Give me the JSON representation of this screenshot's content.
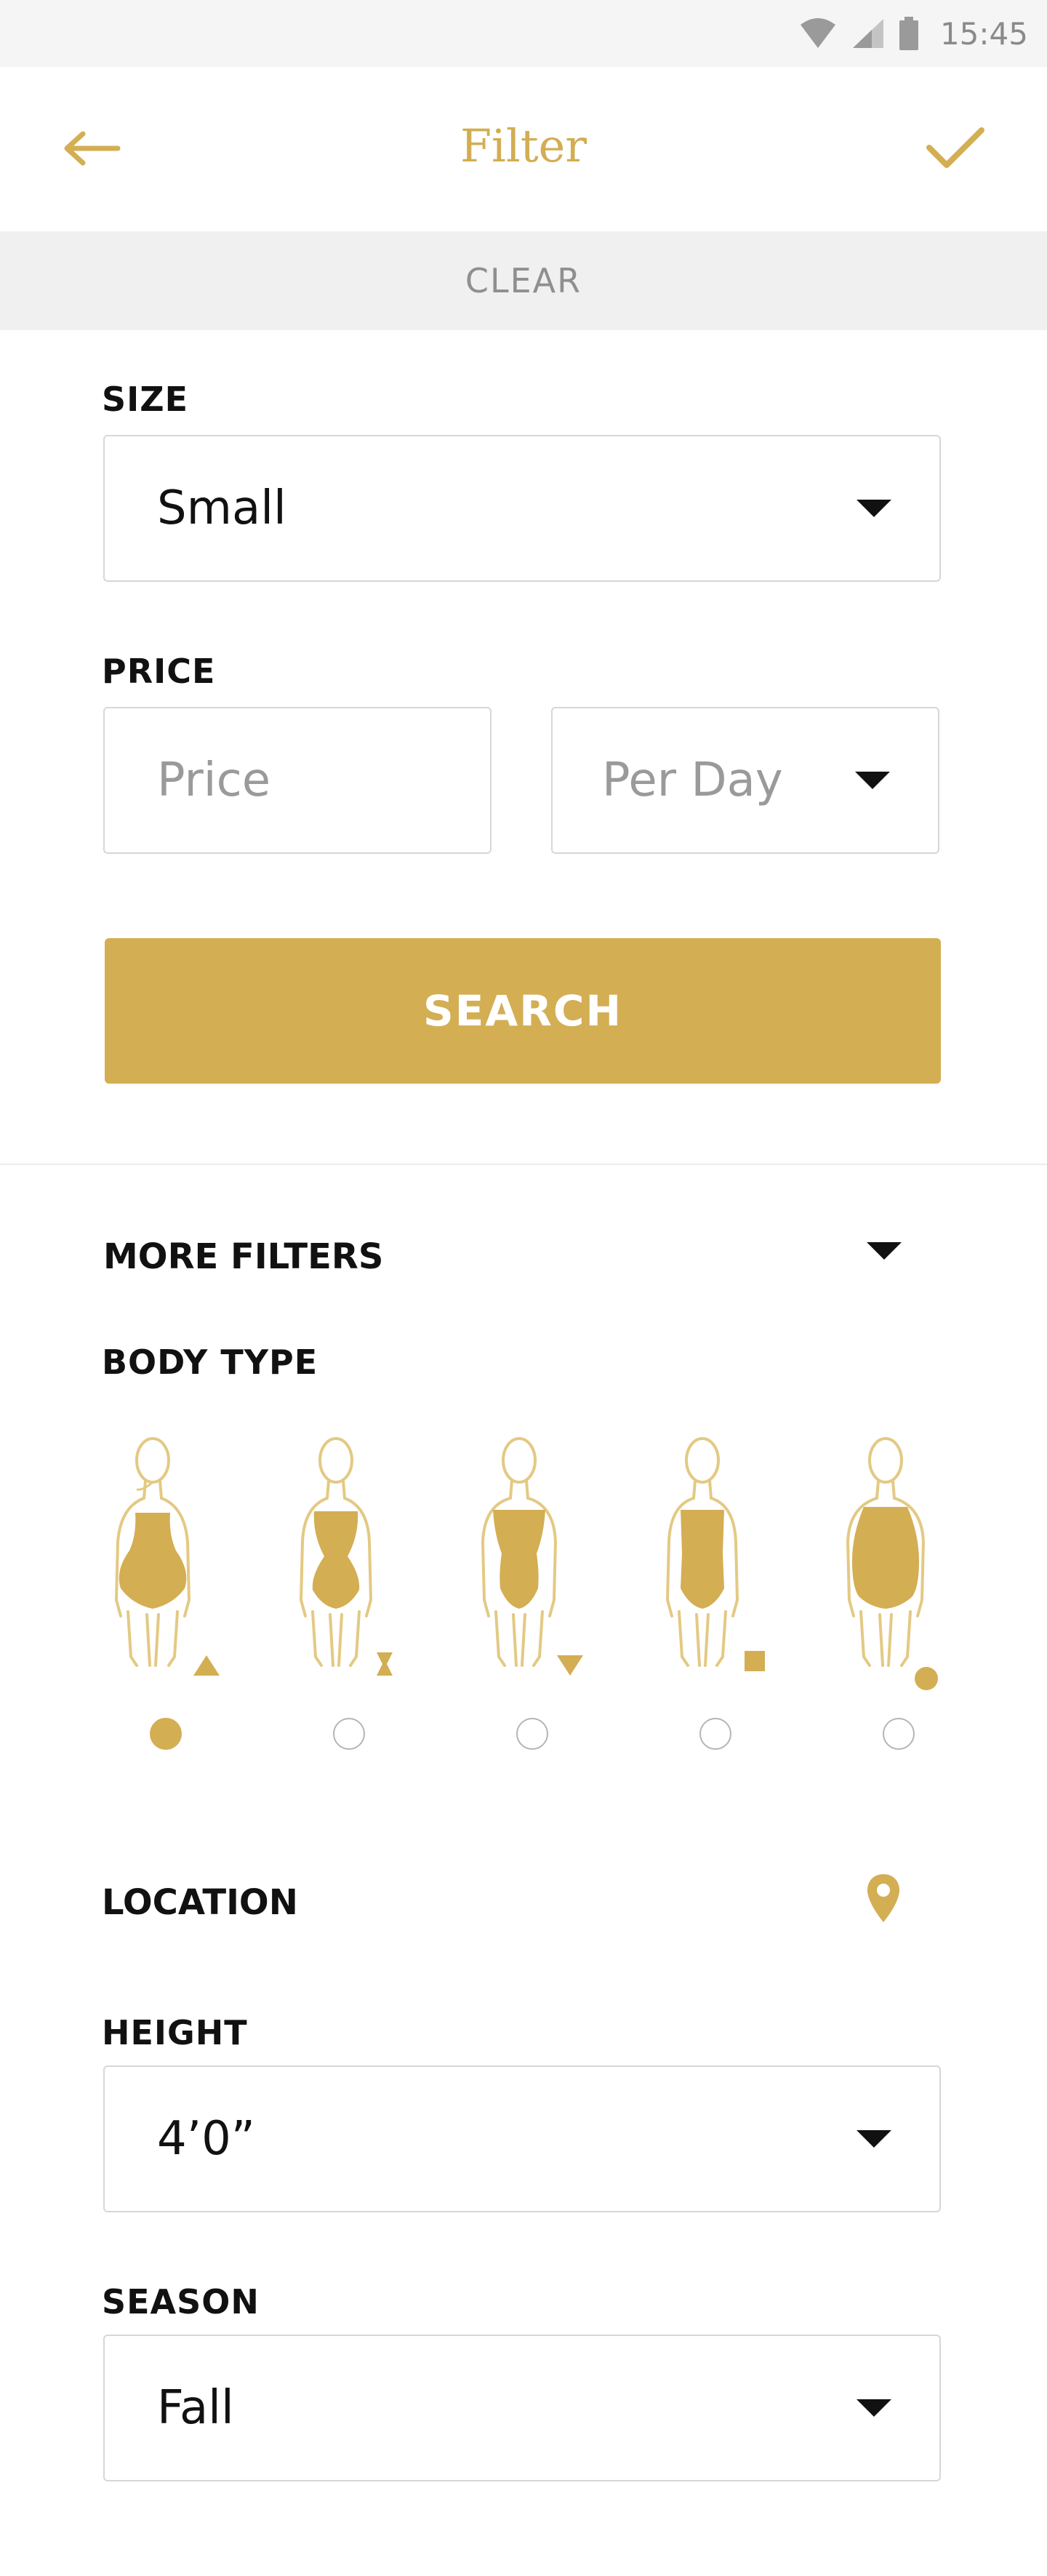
{
  "status_bar": {
    "time": "15:45"
  },
  "header": {
    "title": "Filter"
  },
  "clear": {
    "label": "CLEAR"
  },
  "size": {
    "label": "SIZE",
    "value": "Small"
  },
  "price": {
    "label": "PRICE",
    "placeholder": "Price",
    "period": "Per Day"
  },
  "search": {
    "label": "SEARCH"
  },
  "more_filters": {
    "label": "MORE FILTERS"
  },
  "body_type": {
    "label": "BODY TYPE",
    "options": [
      {
        "shape": "triangle",
        "selected": true
      },
      {
        "shape": "hourglass",
        "selected": false
      },
      {
        "shape": "inverted-triangle",
        "selected": false
      },
      {
        "shape": "rectangle",
        "selected": false
      },
      {
        "shape": "round",
        "selected": false
      }
    ]
  },
  "location": {
    "label": "LOCATION"
  },
  "height": {
    "label": "HEIGHT",
    "value": "4’0”"
  },
  "season": {
    "label": "SEASON",
    "value": "Fall"
  },
  "colors": {
    "accent": "#d3ae53",
    "title": "#d2ad52",
    "clear_bg": "#f0f0f0"
  }
}
